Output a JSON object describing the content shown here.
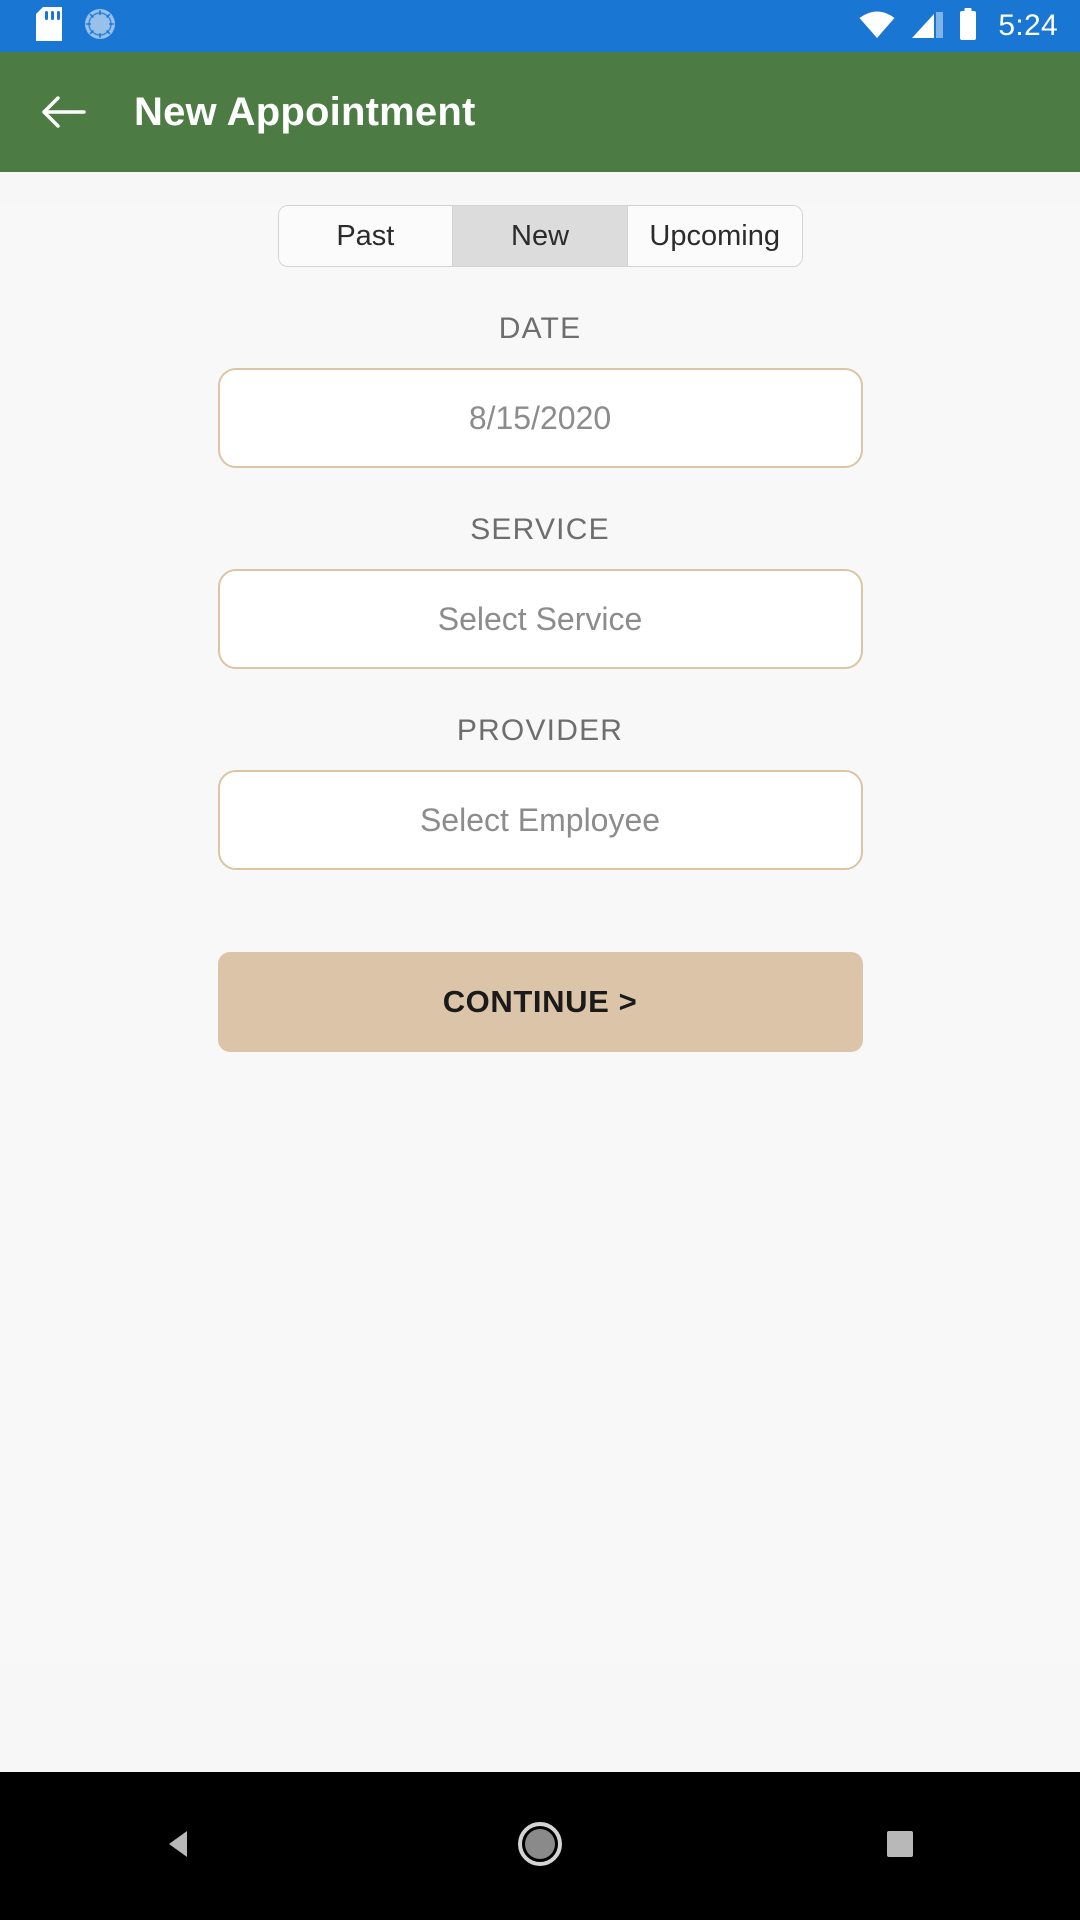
{
  "status_bar": {
    "background": "#1976d2",
    "clock": "5:24",
    "left_icons": [
      {
        "name": "sd-card-icon",
        "label": "SD card"
      },
      {
        "name": "sync-circle-icon",
        "label": "Sync"
      }
    ],
    "right_icons": [
      {
        "name": "wifi-icon",
        "label": "Wi-Fi"
      },
      {
        "name": "cellular-signal-icon",
        "label": "Cellular signal"
      },
      {
        "name": "battery-icon",
        "label": "Battery full"
      }
    ]
  },
  "app_bar": {
    "background": "#4c7c43",
    "title": "New Appointment",
    "back_icon": "arrow-back-icon"
  },
  "tabs": {
    "items": [
      {
        "label": "Past",
        "selected": false
      },
      {
        "label": "New",
        "selected": true
      },
      {
        "label": "Upcoming",
        "selected": false
      }
    ],
    "selected_background": "#dcdcdc"
  },
  "form": {
    "accent_border": "#dbc5a4",
    "fields": [
      {
        "label": "DATE",
        "value": "8/15/2020",
        "placeholder": "8/15/2020",
        "name": "date-field"
      },
      {
        "label": "SERVICE",
        "value": "Select Service",
        "placeholder": "Select Service",
        "name": "service-field"
      },
      {
        "label": "PROVIDER",
        "value": "Select Employee",
        "placeholder": "Select Employee",
        "name": "provider-field"
      }
    ]
  },
  "continue_button": {
    "label": "CONTINUE >",
    "background": "#dcc4a8"
  },
  "nav_bar": {
    "background": "#000000",
    "buttons": [
      {
        "name": "nav-back-button",
        "icon": "triangle-back-icon"
      },
      {
        "name": "nav-home-button",
        "icon": "circle-home-icon"
      },
      {
        "name": "nav-recents-button",
        "icon": "square-recents-icon"
      }
    ]
  }
}
